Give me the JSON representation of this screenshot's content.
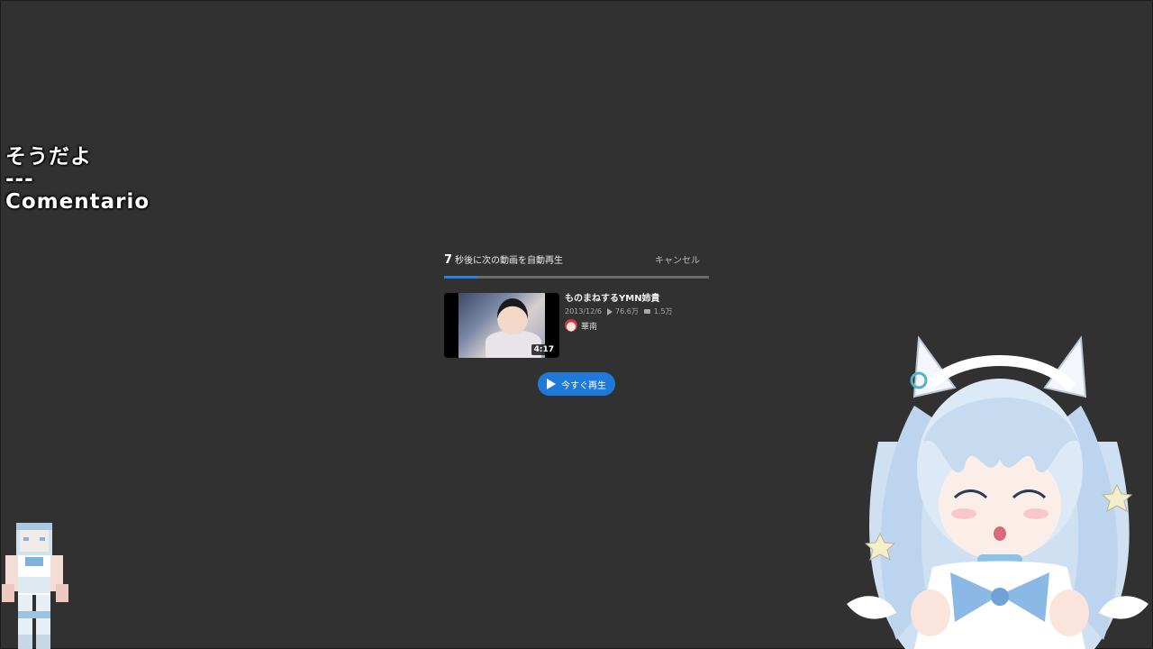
{
  "overlay": {
    "line1": "そうだよ",
    "line2": "---",
    "line3": "Comentario"
  },
  "autoplay": {
    "countdown_number": "7",
    "countdown_text": "秒後に次の動画を自動再生",
    "cancel_label": "キャンセル",
    "progress_fraction": 0.13,
    "video": {
      "title": "ものまねするYMN姉貴",
      "date": "2013/12/6",
      "views": "76.6万",
      "comments": "1.5万",
      "duration": "4:17",
      "owner": "華南"
    },
    "play_now_label": "今すぐ再生"
  },
  "colors": {
    "background": "#313131",
    "accent": "#1f79d8"
  }
}
